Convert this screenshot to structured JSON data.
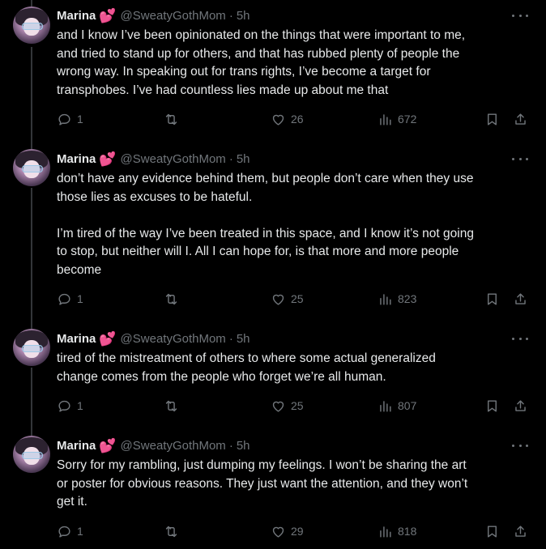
{
  "thread": {
    "tweets": [
      {
        "name": "Marina",
        "emoji": "💕",
        "handle": "@SweatyGothMom",
        "separator": "·",
        "time": "5h",
        "text": "and I know I’ve been opinionated on the things that were important to me,\nand tried to stand up for others, and that has rubbed plenty of people the\nwrong way. In speaking out for trans rights, I’ve become a target for\ntransphobes. I’ve had countless lies made up about me that",
        "replies": "1",
        "reposts": "",
        "likes": "26",
        "views": "672"
      },
      {
        "name": "Marina",
        "emoji": "💕",
        "handle": "@SweatyGothMom",
        "separator": "·",
        "time": "5h",
        "text": "don’t have any evidence behind them, but people don’t care when they use\nthose lies as excuses to be hateful.\n\nI’m tired of the way I’ve been treated in this space, and I know it’s not going\nto stop, but neither will I. All I can hope for, is that more and more people\nbecome",
        "replies": "1",
        "reposts": "",
        "likes": "25",
        "views": "823"
      },
      {
        "name": "Marina",
        "emoji": "💕",
        "handle": "@SweatyGothMom",
        "separator": "·",
        "time": "5h",
        "text": "tired of the mistreatment of others to where some actual generalized\nchange comes from the people who forget we’re all human.",
        "replies": "1",
        "reposts": "",
        "likes": "25",
        "views": "807"
      },
      {
        "name": "Marina",
        "emoji": "💕",
        "handle": "@SweatyGothMom",
        "separator": "·",
        "time": "5h",
        "text": "Sorry for my rambling, just dumping my feelings. I won’t be sharing the art\nor poster for obvious reasons. They just want the attention, and they won’t\nget it.",
        "replies": "1",
        "reposts": "",
        "likes": "29",
        "views": "818"
      }
    ]
  },
  "icons": {
    "reply": "reply-icon",
    "repost": "repost-icon",
    "like": "heart-icon",
    "views": "views-icon",
    "bookmark": "bookmark-icon",
    "share": "share-icon",
    "more": "more-icon"
  },
  "colors": {
    "background": "#000000",
    "text": "#e7e9ea",
    "secondary": "#71767b",
    "heart_emoji": "#f0386b",
    "thread_line": "#333639"
  }
}
